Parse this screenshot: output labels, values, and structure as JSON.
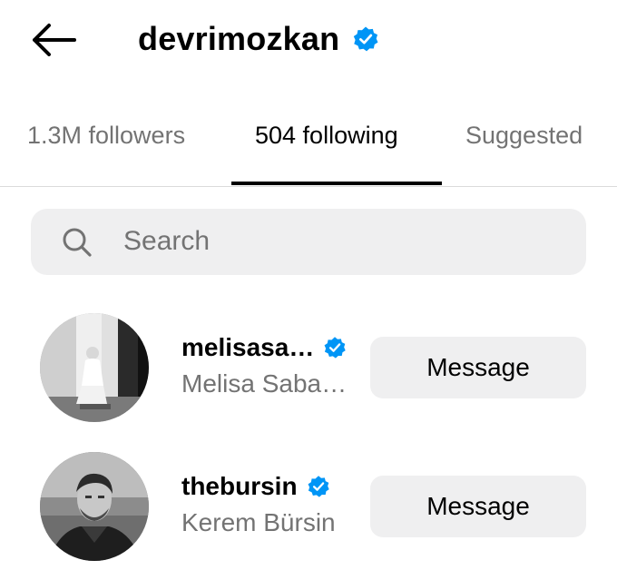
{
  "header": {
    "back_icon": "arrow-left-icon",
    "username": "devrimozkan",
    "verified_icon": "verified-badge-icon"
  },
  "tabs": [
    {
      "label": "1.3M followers",
      "active": false
    },
    {
      "label": "504 following",
      "active": true
    },
    {
      "label": "Suggested",
      "active": false
    }
  ],
  "search": {
    "placeholder": "Search",
    "value": "",
    "icon": "search-icon"
  },
  "accounts": [
    {
      "username": "melisasa…",
      "full_name": "Melisa Saba…",
      "verified": true,
      "button_label": "Message"
    },
    {
      "username": "thebursin",
      "full_name": "Kerem Bürsin",
      "verified": true,
      "button_label": "Message"
    }
  ],
  "colors": {
    "verified_blue": "#0095f6",
    "secondary_text": "#737373",
    "button_bg": "#efeff0",
    "divider": "#dbdbdb"
  }
}
